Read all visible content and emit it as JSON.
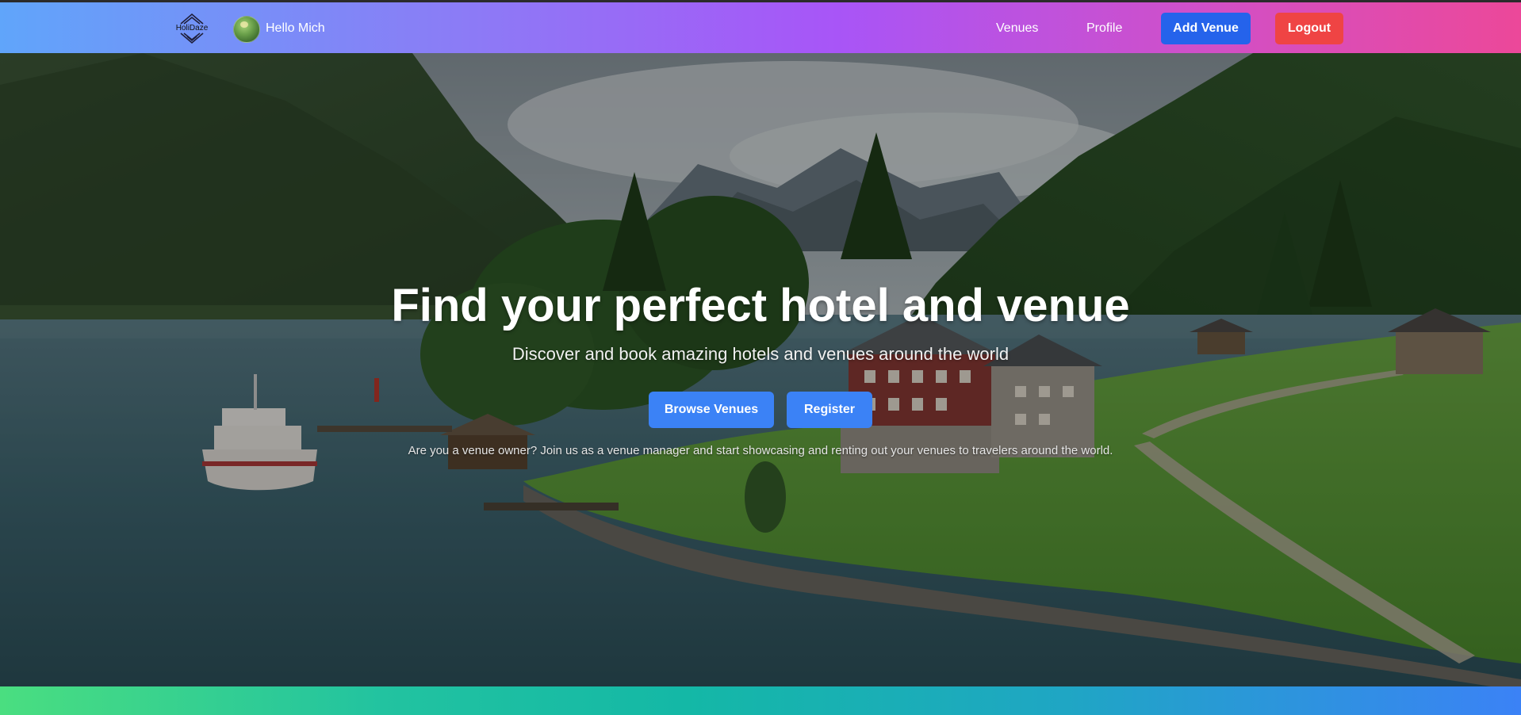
{
  "navbar": {
    "logo_text": "HoliDaze",
    "greeting": "Hello Mich",
    "links": [
      {
        "label": "Venues"
      },
      {
        "label": "Profile"
      }
    ],
    "add_venue_label": "Add Venue",
    "logout_label": "Logout"
  },
  "hero": {
    "title": "Find your perfect hotel and venue",
    "subtitle": "Discover and book amazing hotels and venues around the world",
    "browse_label": "Browse Venues",
    "register_label": "Register",
    "note": "Are you a venue owner? Join us as a venue manager and start showcasing and renting out your venues to travelers around the world."
  },
  "colors": {
    "add_venue": "#2563eb",
    "logout": "#ef4444",
    "primary_button": "#3b82f6"
  },
  "icons": [
    "holidaze-logo-icon",
    "avatar"
  ]
}
